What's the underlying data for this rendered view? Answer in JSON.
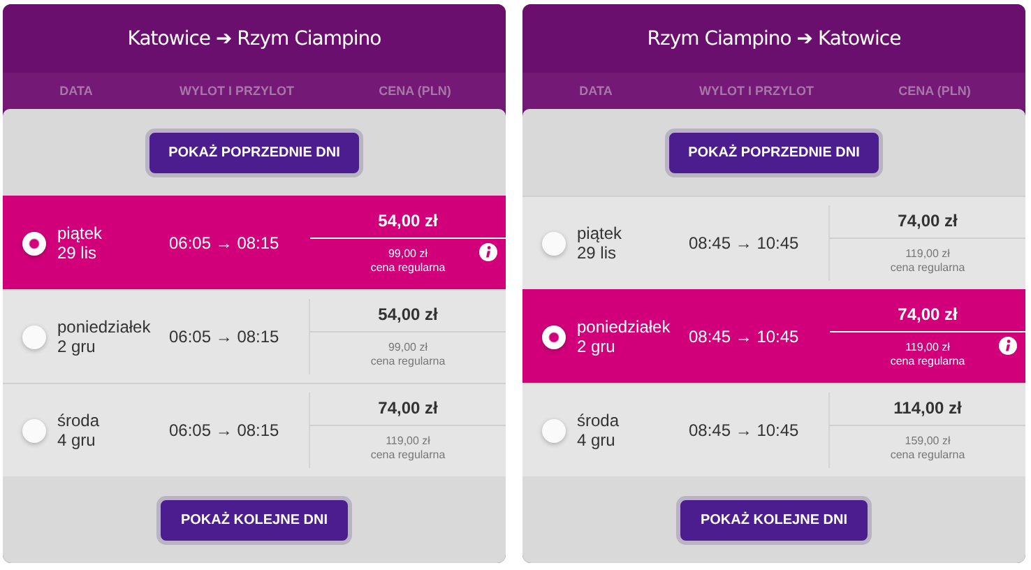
{
  "panels": [
    {
      "title": "Katowice ➔ Rzym Ciampino",
      "columns": [
        "DATA",
        "WYLOT I PRZYLOT",
        "CENA (PLN)"
      ],
      "prev_button": "POKAŻ POPRZEDNIE DNI",
      "next_button": "POKAŻ KOLEJNE DNI",
      "flights": [
        {
          "day": "piątek",
          "date": "29 lis",
          "time": "06:05 → 08:15",
          "price": "54,00 zł",
          "regular_price": "99,00 zł",
          "regular_label": "cena regularna",
          "selected": true
        },
        {
          "day": "poniedziałek",
          "date": "2 gru",
          "time": "06:05 → 08:15",
          "price": "54,00 zł",
          "regular_price": "99,00 zł",
          "regular_label": "cena regularna",
          "selected": false
        },
        {
          "day": "środa",
          "date": "4 gru",
          "time": "06:05 → 08:15",
          "price": "74,00 zł",
          "regular_price": "119,00 zł",
          "regular_label": "cena regularna",
          "selected": false
        }
      ]
    },
    {
      "title": "Rzym Ciampino ➔ Katowice",
      "columns": [
        "DATA",
        "WYLOT I PRZYLOT",
        "CENA (PLN)"
      ],
      "prev_button": "POKAŻ POPRZEDNIE DNI",
      "next_button": "POKAŻ KOLEJNE DNI",
      "flights": [
        {
          "day": "piątek",
          "date": "29 lis",
          "time": "08:45 → 10:45",
          "price": "74,00 zł",
          "regular_price": "119,00 zł",
          "regular_label": "cena regularna",
          "selected": false
        },
        {
          "day": "poniedziałek",
          "date": "2 gru",
          "time": "08:45 → 10:45",
          "price": "74,00 zł",
          "regular_price": "119,00 zł",
          "regular_label": "cena regularna",
          "selected": true
        },
        {
          "day": "środa",
          "date": "4 gru",
          "time": "08:45 → 10:45",
          "price": "114,00 zł",
          "regular_price": "159,00 zł",
          "regular_label": "cena regularna",
          "selected": false
        }
      ]
    }
  ]
}
